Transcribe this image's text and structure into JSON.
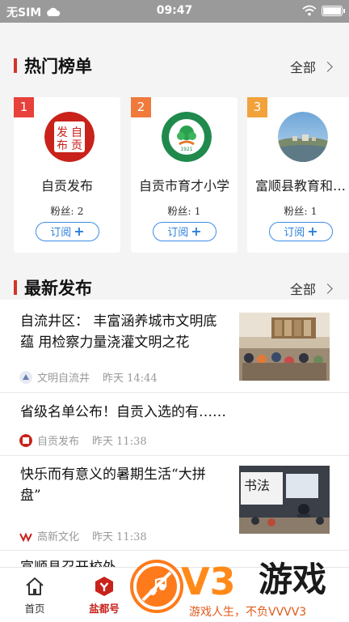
{
  "status_bar": {
    "carrier": "无SIM",
    "time": "09:47"
  },
  "hot": {
    "title": "热门榜单",
    "more": "全部",
    "cards": [
      {
        "rank": "1",
        "rank_color": "#e8403a",
        "name": "自贡发布",
        "fans": "粉丝: 2",
        "subscribe": "订阅",
        "logo_text": [
          "发",
          "自",
          "布",
          "贡"
        ]
      },
      {
        "rank": "2",
        "rank_color": "#f07a3c",
        "name": "自贡市育才小学",
        "fans": "粉丝: 1",
        "subscribe": "订阅",
        "logo_text": [
          "1921"
        ]
      },
      {
        "rank": "3",
        "rank_color": "#f2a23a",
        "name": "富顺县教育和…",
        "fans": "粉丝: 1",
        "subscribe": "订阅",
        "logo_text": []
      }
    ]
  },
  "latest": {
    "title": "最新发布",
    "more": "全部",
    "items": [
      {
        "lines": [
          "自流井区： 丰富涵养城市文明底",
          "蕴 用检察力量浇灌文明之花"
        ],
        "source": "文明自流井",
        "time": "昨天 14:44",
        "has_thumb": true
      },
      {
        "lines": [
          "省级名单公布！自贡入选的有……"
        ],
        "source": "自贡发布",
        "time": "昨天 11:38",
        "has_thumb": false
      },
      {
        "lines": [
          "快乐而有意义的暑期生活“大拼",
          "盘”"
        ],
        "source": "高新文化",
        "time": "昨天 11:38",
        "has_thumb": true,
        "thumb_text": "书法"
      },
      {
        "lines": [
          "富顺县召开校外"
        ],
        "source": "",
        "time": "",
        "has_thumb": false
      }
    ]
  },
  "tabbar": {
    "home": "首页",
    "second": "盐都号"
  },
  "watermark": {
    "brand": "V3",
    "brand_cn": "游戏",
    "slogan": "游戏人生，不负VVVV3"
  },
  "colors": {
    "accent_red": "#d0342c",
    "link_blue": "#2a7fdc"
  }
}
